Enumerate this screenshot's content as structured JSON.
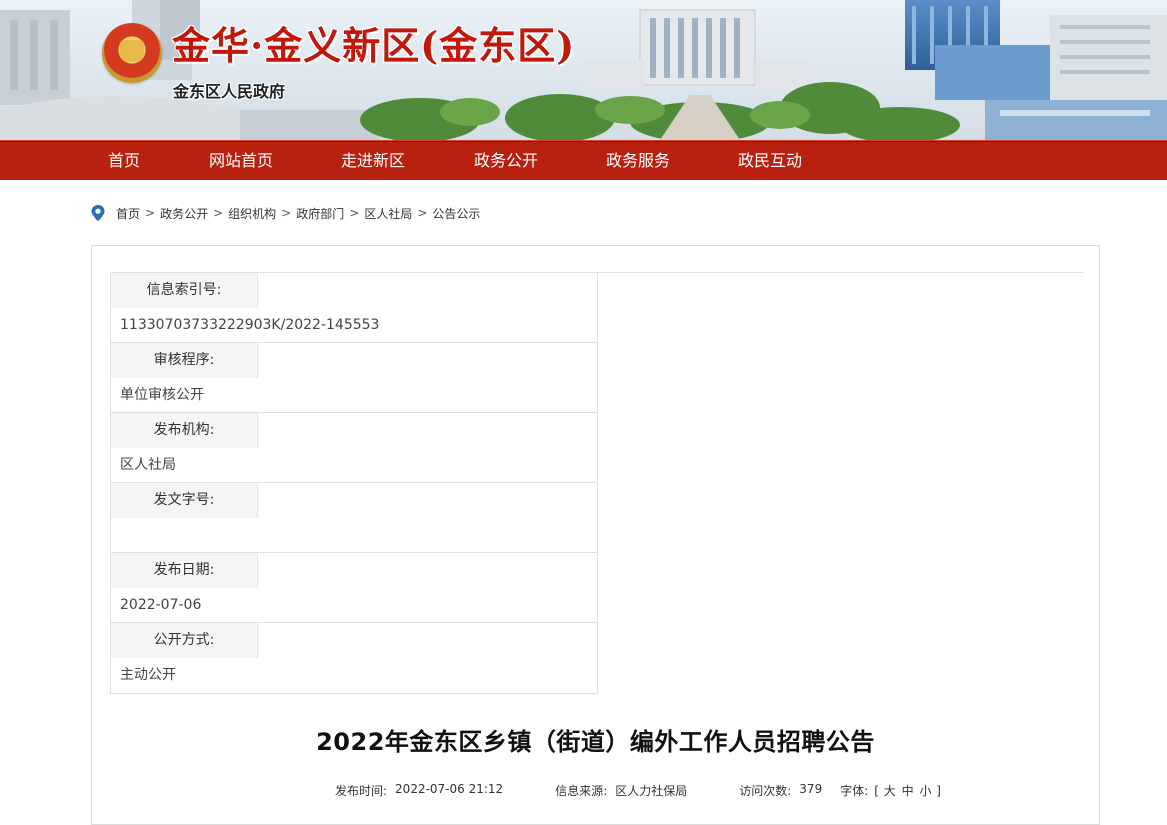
{
  "header": {
    "title": "金华·金义新区(金东区)",
    "subtitle": "金东区人民政府",
    "emblem_icon": "national-emblem-icon"
  },
  "nav": {
    "items": [
      {
        "label": "首页"
      },
      {
        "label": "网站首页"
      },
      {
        "label": "走进新区"
      },
      {
        "label": "政务公开"
      },
      {
        "label": "政务服务"
      },
      {
        "label": "政民互动"
      }
    ],
    "color": "#b8200f"
  },
  "breadcrumb": {
    "icon": "location-pin-icon",
    "items": [
      "首页",
      "政务公开",
      "组织机构",
      "政府部门",
      "区人社局",
      "公告公示"
    ],
    "separator": ">"
  },
  "info": {
    "rows": [
      {
        "label": "信息索引号:",
        "value": "11330703733222903K/2022-145553"
      },
      {
        "label": "审核程序:",
        "value": "单位审核公开"
      },
      {
        "label": "发布机构:",
        "value": "区人社局"
      },
      {
        "label": "发文字号:",
        "value": ""
      },
      {
        "label": "发布日期:",
        "value": "2022-07-06"
      },
      {
        "label": "公开方式:",
        "value": "主动公开"
      }
    ]
  },
  "article": {
    "title": "2022年金东区乡镇（街道）编外工作人员招聘公告",
    "publish_label": "发布时间:",
    "publish_time": "2022-07-06 21:12",
    "source_label": "信息来源:",
    "source": "区人力社保局",
    "visits_label": "访问次数:",
    "visits": "379",
    "font_label": "字体:",
    "font_open": "[",
    "font_large": "大",
    "font_medium": "中",
    "font_small": "小",
    "font_close": "]"
  }
}
